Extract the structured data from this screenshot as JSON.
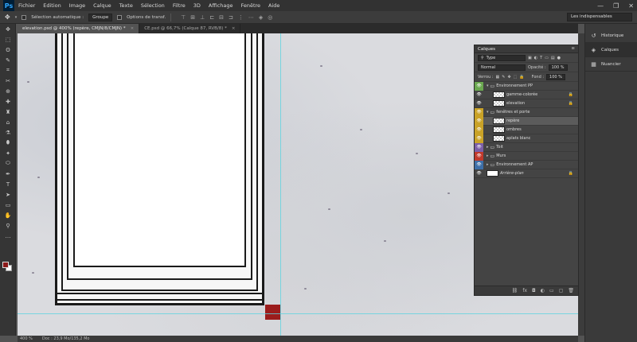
{
  "menubar": {
    "logo": "Ps",
    "items": [
      "Fichier",
      "Edition",
      "Image",
      "Calque",
      "Texte",
      "Sélection",
      "Filtre",
      "3D",
      "Affichage",
      "Fenêtre",
      "Aide"
    ],
    "window_controls": [
      "—",
      "❐",
      "✕"
    ]
  },
  "options": {
    "auto_select_label": "Sélection automatique :",
    "auto_select_value": "Groupe",
    "transform_label": "Options de transf.",
    "workspace": "Les indispensables"
  },
  "tabs": [
    {
      "label": "elevation.psd @ 400% (repère, CMJN/8/CMJN) *",
      "active": true
    },
    {
      "label": "CE.psd @ 66,7% (Calque 87, RVB/8) *",
      "active": false
    }
  ],
  "tools": [
    "✥",
    "⬚",
    "ʘ",
    "✎",
    "⌗",
    "✂",
    "⊕",
    "✚",
    "♜",
    "⌂",
    "⚗",
    "⬮",
    "✦",
    "⬭",
    "✒",
    "T",
    "➤",
    "▭",
    "✋",
    "⚲",
    "…"
  ],
  "status": {
    "zoom": "400 %",
    "doc": "Doc : 23,9 Mo/135,2 Mo"
  },
  "side_panels": [
    {
      "label": "Historique",
      "icon": "history-icon",
      "selected": false
    },
    {
      "label": "Calques",
      "icon": "layers-icon",
      "selected": true
    },
    {
      "label": "Nuancier",
      "icon": "swatches-icon",
      "selected": false
    }
  ],
  "layers_panel": {
    "title": "Calques",
    "filter_label": "Type",
    "blend_mode": "Normal",
    "opacity_label": "Opacité :",
    "opacity_value": "100 %",
    "lock_label": "Verrou :",
    "fill_label": "Fond :",
    "fill_value": "100 %",
    "layers": [
      {
        "name": "Environnement PP",
        "type": "folder",
        "color": "#6aa84f",
        "indent": 0,
        "expanded": true,
        "locked": false,
        "selected": false
      },
      {
        "name": "gamme-colorée",
        "type": "layer",
        "color": "",
        "indent": 1,
        "locked": true,
        "selected": false
      },
      {
        "name": "elevation",
        "type": "layer",
        "color": "",
        "indent": 1,
        "locked": true,
        "selected": false
      },
      {
        "name": "fenêtres et porte",
        "type": "folder",
        "color": "#c9a227",
        "indent": 0,
        "expanded": true,
        "locked": false,
        "selected": false
      },
      {
        "name": "repère",
        "type": "layer",
        "color": "#c9a227",
        "indent": 1,
        "locked": false,
        "selected": true
      },
      {
        "name": "ombres",
        "type": "layer",
        "color": "#c9a227",
        "indent": 1,
        "locked": false,
        "selected": false
      },
      {
        "name": "aplats blanc",
        "type": "layer",
        "color": "#c9a227",
        "indent": 1,
        "locked": false,
        "selected": false
      },
      {
        "name": "Toit",
        "type": "folder",
        "color": "#7b5ea7",
        "indent": 0,
        "expanded": false,
        "locked": false,
        "selected": false
      },
      {
        "name": "Murs",
        "type": "folder",
        "color": "#c0392b",
        "indent": 0,
        "expanded": false,
        "locked": false,
        "selected": false
      },
      {
        "name": "Environnement AP",
        "type": "folder",
        "color": "#3d6fa8",
        "indent": 0,
        "expanded": false,
        "locked": false,
        "selected": false
      },
      {
        "name": "Arrière-plan",
        "type": "background",
        "color": "",
        "indent": 0,
        "locked": true,
        "selected": false
      }
    ],
    "footer_icons": [
      "link-icon",
      "fx-icon",
      "mask-icon",
      "adjustment-icon",
      "group-icon",
      "new-layer-icon",
      "trash-icon"
    ]
  },
  "colors": {
    "foreground": "#8b1a1a",
    "background": "#ffffff",
    "guide": "#5fd3e0",
    "marker": "#9b1c1c"
  }
}
